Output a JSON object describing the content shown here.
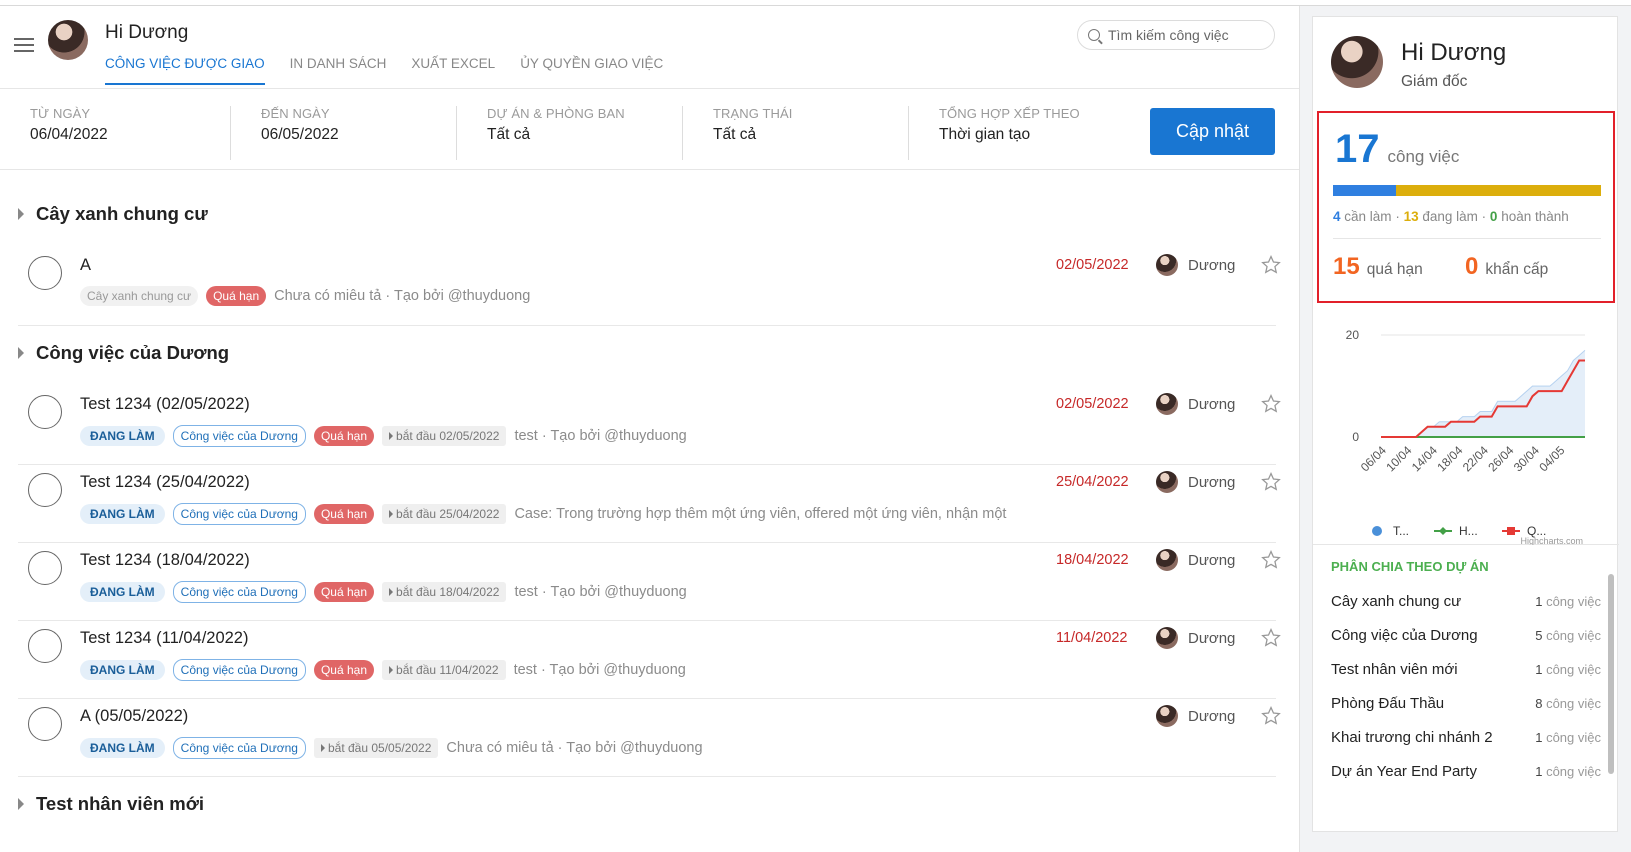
{
  "header": {
    "greeting": "Hi Dương",
    "tabs": [
      {
        "label": "CÔNG VIỆC ĐƯỢC GIAO",
        "active": true
      },
      {
        "label": "IN DANH SÁCH"
      },
      {
        "label": "XUẤT EXCEL"
      },
      {
        "label": "ỦY QUYỀN GIAO VIỆC"
      }
    ],
    "search_placeholder": "Tìm kiếm công việc"
  },
  "filters": {
    "from_label": "TỪ NGÀY",
    "from_value": "06/04/2022",
    "to_label": "ĐẾN NGÀY",
    "to_value": "06/05/2022",
    "project_label": "DỰ ÁN & PHÒNG BAN",
    "project_value": "Tất cả",
    "status_label": "TRẠNG THÁI",
    "status_value": "Tất cả",
    "sort_label": "TỔNG HỢP XẾP THEO",
    "sort_value": "Thời gian tạo",
    "update_button": "Cập nhật"
  },
  "groups": [
    {
      "name": "Cây xanh chung cư"
    },
    {
      "name": "Công việc của Dương"
    },
    {
      "name": "Test nhân viên mới"
    }
  ],
  "tasks": [
    {
      "title": "A",
      "project_tag": "Cây xanh chung cư",
      "overdue": "Quá hạn",
      "desc": "Chưa có miêu tả · Tạo bởi @thuyduong",
      "date": "02/05/2022",
      "assignee": "Dương"
    },
    {
      "title": "Test 1234 (02/05/2022)",
      "status": "ĐANG LÀM",
      "project_tag": "Công việc của Dương",
      "overdue": "Quá hạn",
      "start": "bắt đầu 02/05/2022",
      "desc": "test · Tạo bởi @thuyduong",
      "date": "02/05/2022",
      "assignee": "Dương"
    },
    {
      "title": "Test 1234 (25/04/2022)",
      "status": "ĐANG LÀM",
      "project_tag": "Công việc của Dương",
      "overdue": "Quá hạn",
      "start": "bắt đầu 25/04/2022",
      "desc": "Case:  Trong trường hợp thêm một ứng viên, offered một ứng viên, nhận một ứ",
      "date": "25/04/2022",
      "assignee": "Dương"
    },
    {
      "title": "Test 1234 (18/04/2022)",
      "status": "ĐANG LÀM",
      "project_tag": "Công việc của Dương",
      "overdue": "Quá hạn",
      "start": "bắt đầu 18/04/2022",
      "desc": "test · Tạo bởi @thuyduong",
      "date": "18/04/2022",
      "assignee": "Dương"
    },
    {
      "title": "Test 1234 (11/04/2022)",
      "status": "ĐANG LÀM",
      "project_tag": "Công việc của Dương",
      "overdue": "Quá hạn",
      "start": "bắt đầu 11/04/2022",
      "desc": "test · Tạo bởi @thuyduong",
      "date": "11/04/2022",
      "assignee": "Dương"
    },
    {
      "title": "A (05/05/2022)",
      "status": "ĐANG LÀM",
      "project_tag": "Công việc của Dương",
      "start": "bắt đầu 05/05/2022",
      "desc": "Chưa có miêu tả · Tạo bởi @thuyduong",
      "date": "",
      "assignee": "Dương"
    }
  ],
  "side": {
    "name": "Hi Dương",
    "role": "Giám đốc",
    "total": "17",
    "total_unit": "công việc",
    "todo_count": "4",
    "todo_label": "cần làm",
    "doing_count": "13",
    "doing_label": "đang làm",
    "done_count": "0",
    "done_label": "hoàn thành",
    "overdue_count": "15",
    "overdue_label": "quá hạn",
    "urgent_count": "0",
    "urgent_label": "khẩn cấp",
    "colors": {
      "todo": "#2f7fe0",
      "doing": "#dcae0c",
      "done": "#43a047",
      "overdue": "#f26522"
    },
    "bar_fractions": {
      "todo": 0.235,
      "doing": 0.765
    },
    "project_title": "PHÂN CHIA THEO DỰ ÁN",
    "projects": [
      {
        "name": "Cây xanh chung cư",
        "count": "1",
        "unit": "công việc"
      },
      {
        "name": "Công việc của Dương",
        "count": "5",
        "unit": "công việc"
      },
      {
        "name": "Test nhân viên mới",
        "count": "1",
        "unit": "công việc"
      },
      {
        "name": "Phòng Đấu Thầu",
        "count": "8",
        "unit": "công việc"
      },
      {
        "name": "Khai trương chi nhánh 2",
        "count": "1",
        "unit": "công việc"
      },
      {
        "name": "Dự án Year End Party",
        "count": "1",
        "unit": "công việc"
      }
    ]
  },
  "chart_data": {
    "type": "line",
    "x_ticks": [
      "06/04",
      "10/04",
      "14/04",
      "18/04",
      "22/04",
      "26/04",
      "30/04",
      "04/05"
    ],
    "y_ticks": [
      0,
      20
    ],
    "ylim": [
      0,
      20
    ],
    "credit": "Highcharts.com",
    "series": [
      {
        "name": "T...",
        "type": "area",
        "color": "#4a90d9",
        "values": [
          0,
          0,
          0,
          0,
          0,
          0,
          0,
          1,
          2,
          2,
          3,
          3,
          3,
          3,
          4,
          4,
          4,
          5,
          5,
          5,
          7,
          7,
          7,
          7,
          8,
          9,
          10,
          10,
          10,
          10,
          11,
          12,
          13,
          15,
          16,
          17
        ]
      },
      {
        "name": "H...",
        "type": "line",
        "color": "#43a047",
        "values": [
          0,
          0,
          0,
          0,
          0,
          0,
          0,
          0,
          0,
          0,
          0,
          0,
          0,
          0,
          0,
          0,
          0,
          0,
          0,
          0,
          0,
          0,
          0,
          0,
          0,
          0,
          0,
          0,
          0,
          0,
          0,
          0,
          0,
          0,
          0,
          0
        ]
      },
      {
        "name": "Q...",
        "type": "line",
        "color": "#e53935",
        "values": [
          0,
          0,
          0,
          0,
          0,
          0,
          0,
          1,
          2,
          2,
          2,
          2,
          3,
          3,
          3,
          3,
          3,
          4,
          4,
          4,
          6,
          6,
          6,
          6,
          6,
          6,
          8,
          9,
          9,
          9,
          9,
          9,
          11,
          13,
          15,
          15
        ]
      }
    ]
  }
}
